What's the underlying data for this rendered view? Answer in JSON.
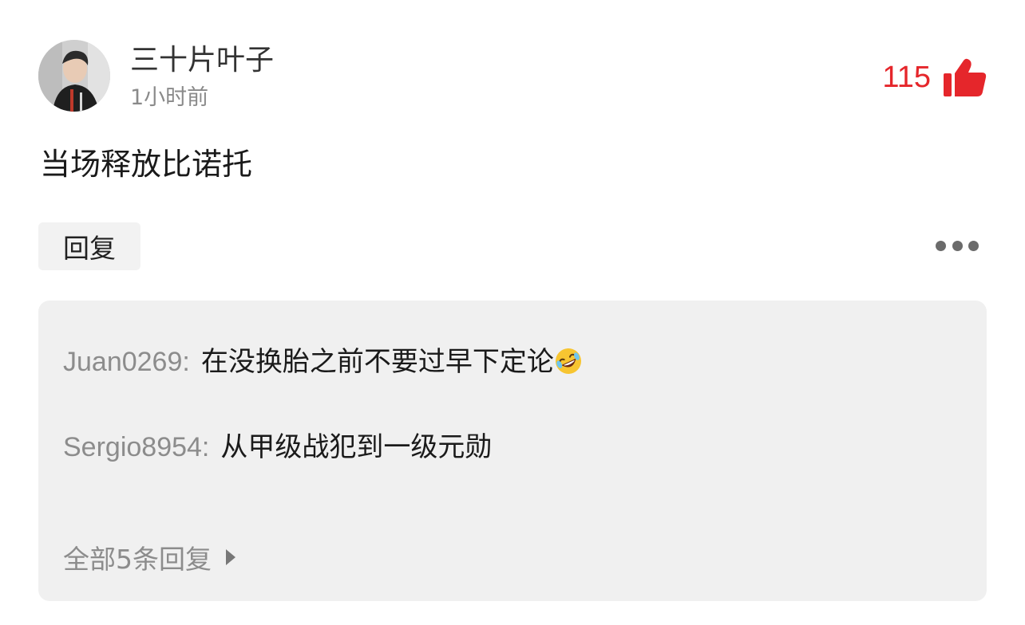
{
  "comment": {
    "username": "三十片叶子",
    "timestamp": "1小时前",
    "text": "当场释放比诺托",
    "likes": "115",
    "like_color": "#e5262b",
    "reply_label": "回复",
    "more_icon": "more-dots-icon"
  },
  "replies": {
    "items": [
      {
        "author": "Juan0269",
        "colon": ":",
        "text": "在没换胎之前不要过早下定论",
        "emoji": "rolling-on-floor-laughing"
      },
      {
        "author": "Sergio8954",
        "colon": ":",
        "text": "从甲级战犯到一级元勋"
      }
    ],
    "view_all": "全部5条回复"
  }
}
